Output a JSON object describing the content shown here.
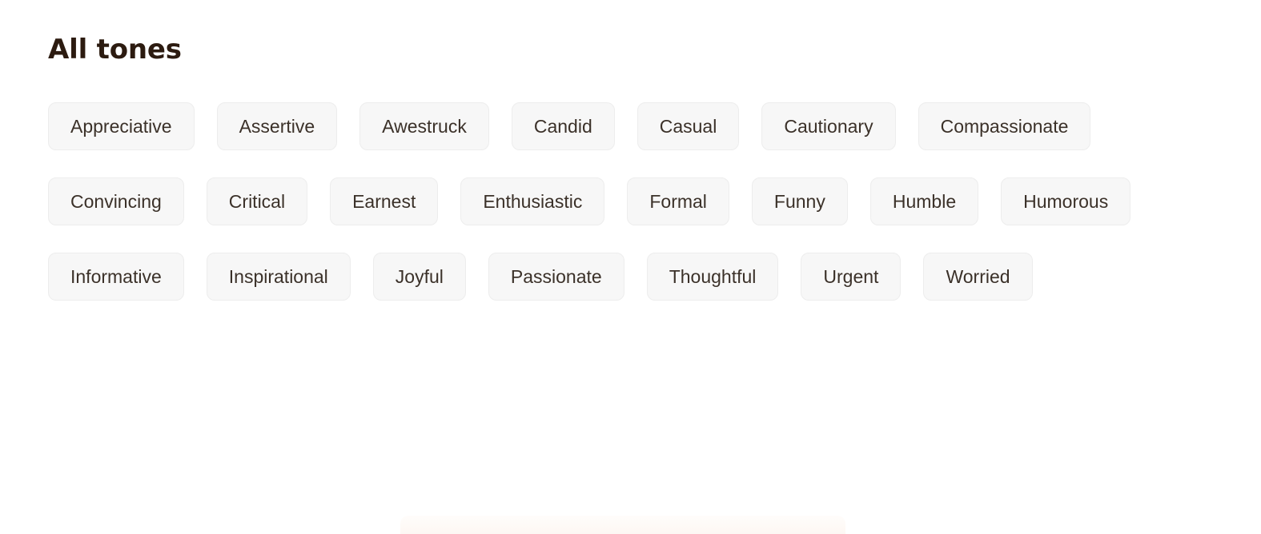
{
  "page": {
    "background_color": "#ffffff",
    "title": "All tones"
  },
  "colors": {
    "heading": "#2c1b10",
    "chip_background": "#f7f7f7",
    "chip_border": "#ededed",
    "chip_text": "#3b3129",
    "bottom_panel": "#fdf8f4"
  },
  "tones": {
    "heading": "All tones",
    "items": [
      {
        "label": "Appreciative"
      },
      {
        "label": "Assertive"
      },
      {
        "label": "Awestruck"
      },
      {
        "label": "Candid"
      },
      {
        "label": "Casual"
      },
      {
        "label": "Cautionary"
      },
      {
        "label": "Compassionate"
      },
      {
        "label": "Convincing"
      },
      {
        "label": "Critical"
      },
      {
        "label": "Earnest"
      },
      {
        "label": "Enthusiastic"
      },
      {
        "label": "Formal"
      },
      {
        "label": "Funny"
      },
      {
        "label": "Humble"
      },
      {
        "label": "Humorous"
      },
      {
        "label": "Informative"
      },
      {
        "label": "Inspirational"
      },
      {
        "label": "Joyful"
      },
      {
        "label": "Passionate"
      },
      {
        "label": "Thoughtful"
      },
      {
        "label": "Urgent"
      },
      {
        "label": "Worried"
      }
    ]
  }
}
